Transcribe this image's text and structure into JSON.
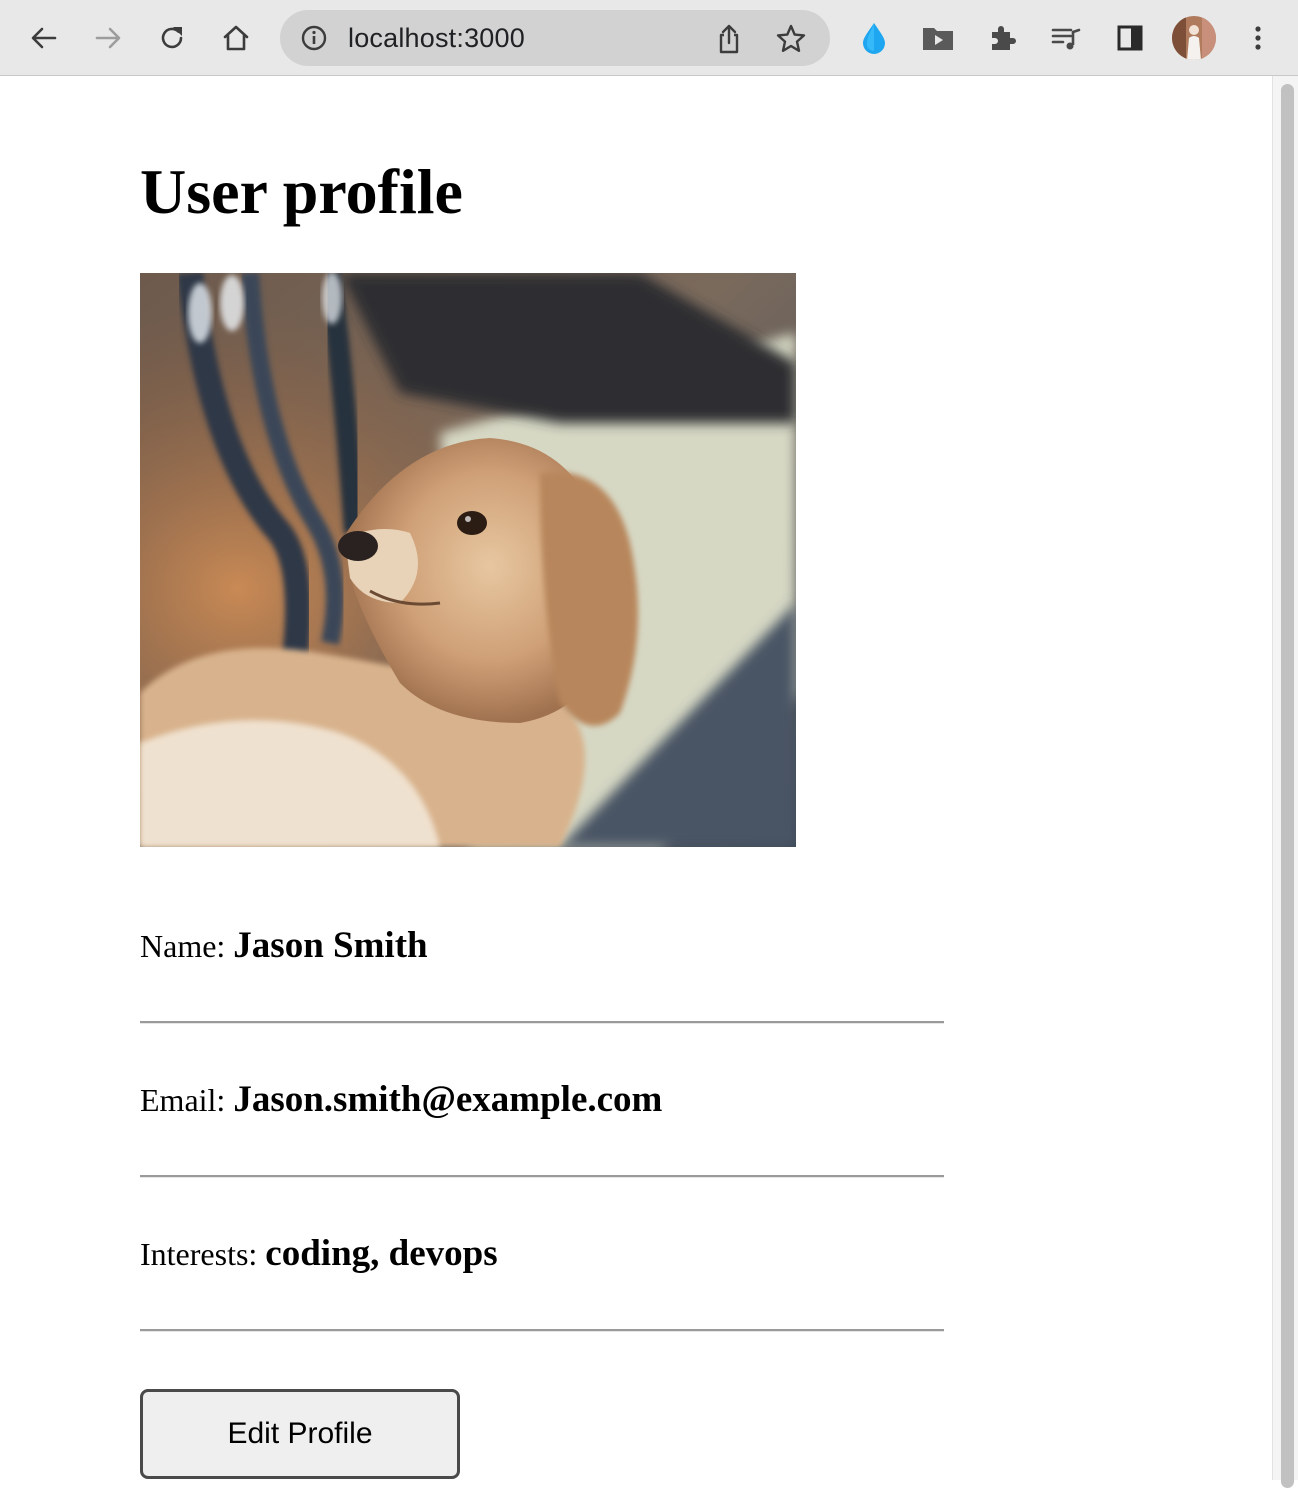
{
  "browser": {
    "url": "localhost:3000",
    "icons": [
      "back-icon",
      "forward-icon",
      "reload-icon",
      "home-icon",
      "site-info-icon",
      "share-icon",
      "bookmark-star-icon",
      "raindrop-extension-icon",
      "video-folder-extension-icon",
      "extensions-puzzle-icon",
      "media-queue-icon",
      "side-panel-icon",
      "profile-avatar",
      "menu-kebab-icon"
    ]
  },
  "page": {
    "title": "User profile",
    "photo": {
      "subject": "dog-photo"
    },
    "fields": [
      {
        "label": "Name: ",
        "value": "Jason Smith"
      },
      {
        "label": "Email: ",
        "value": "Jason.smith@example.com"
      },
      {
        "label": "Interests: ",
        "value": "coding, devops"
      }
    ],
    "edit_button_label": "Edit Profile"
  },
  "colors": {
    "chrome_bg": "#e8e8e8",
    "omnibox_bg": "#d2d2d2",
    "raindrop_blue": "#1ea7f0",
    "button_bg": "#efefef"
  }
}
